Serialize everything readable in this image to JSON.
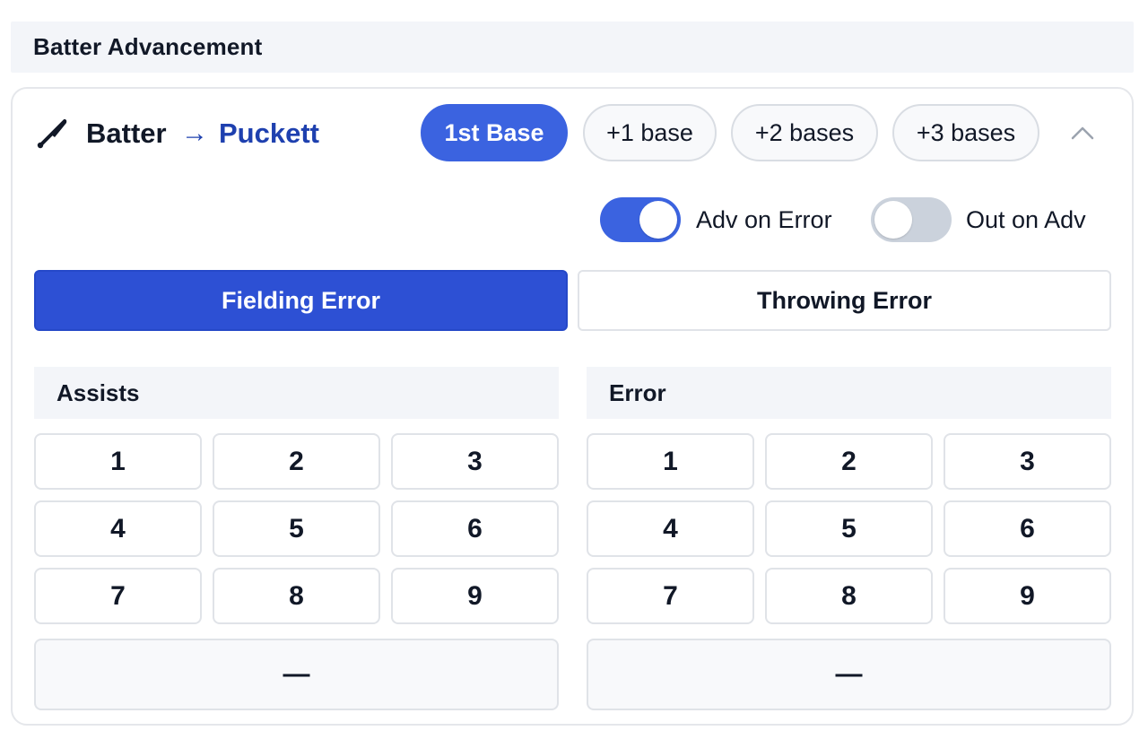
{
  "section": {
    "title": "Batter Advancement"
  },
  "batter": {
    "label": "Batter",
    "arrow": "→",
    "player": "Puckett"
  },
  "advance_options": [
    {
      "label": "1st Base",
      "active": true
    },
    {
      "label": "+1 base",
      "active": false
    },
    {
      "label": "+2 bases",
      "active": false
    },
    {
      "label": "+3 bases",
      "active": false
    }
  ],
  "toggles": [
    {
      "label": "Adv on Error",
      "on": true
    },
    {
      "label": "Out on Adv",
      "on": false
    }
  ],
  "error_types": [
    {
      "label": "Fielding Error",
      "active": true
    },
    {
      "label": "Throwing Error",
      "active": false
    }
  ],
  "assists": {
    "title": "Assists",
    "keys": [
      "1",
      "2",
      "3",
      "4",
      "5",
      "6",
      "7",
      "8",
      "9"
    ],
    "clear": "—"
  },
  "error": {
    "title": "Error",
    "keys": [
      "1",
      "2",
      "3",
      "4",
      "5",
      "6",
      "7",
      "8",
      "9"
    ],
    "clear": "—"
  },
  "icons": {
    "bat": "baseball-bat-icon",
    "collapse": "chevron-up-icon"
  },
  "colors": {
    "accent": "#3b63e0",
    "accent_dark": "#2d50d4",
    "player": "#1e40af"
  }
}
